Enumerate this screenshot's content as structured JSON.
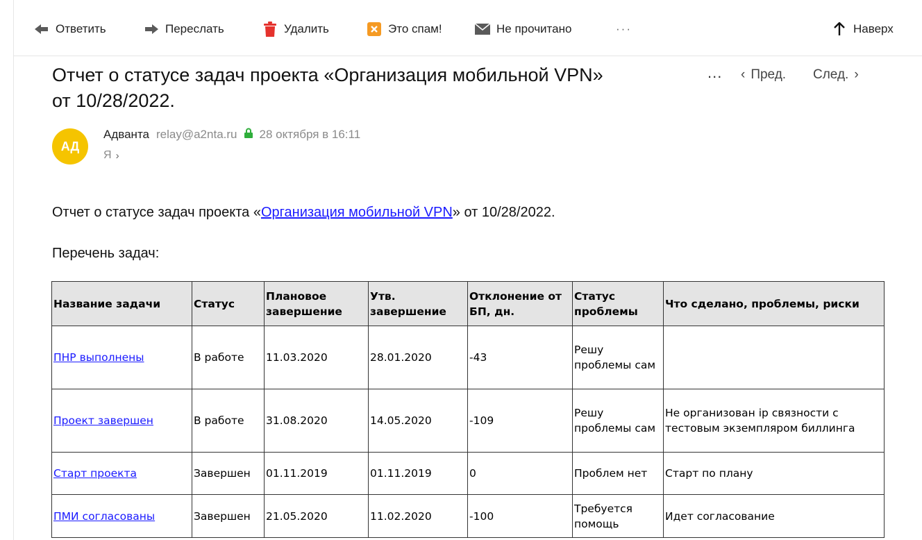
{
  "toolbar": {
    "reply": "Ответить",
    "forward": "Переслать",
    "delete": "Удалить",
    "spam": "Это спам!",
    "unread": "Не прочитано",
    "more": "···",
    "top": "Наверх"
  },
  "email": {
    "subject_line1": "Отчет о статусе задач проекта «Организация мобильной VPN»",
    "subject_line2": "от 10/28/2022.",
    "subject_more": "...",
    "prev": "Пред.",
    "next": "След.",
    "sender": {
      "avatar_initials": "АД",
      "name": "Адванта",
      "email": "relay@a2nta.ru",
      "date": "28 октября в 16:11",
      "recipient": "Я"
    },
    "intro_before": "Отчет о статусе задач проекта «",
    "intro_link": "Организация мобильной VPN",
    "intro_after": "» от 10/28/2022.",
    "list_title": "Перечень задач:"
  },
  "table": {
    "headers": [
      "Название задачи",
      "Статус",
      "Плановое завершение",
      "Утв. завершение",
      "Отклонение от БП, дн.",
      "Статус проблемы",
      "Что сделано, проблемы, риски"
    ],
    "rows": [
      {
        "name": "ПНР выполнены",
        "status": "В работе",
        "planned": "11.03.2020",
        "approved": "28.01.2020",
        "deviation": "-43",
        "problem": "Решу проблемы сам",
        "notes": ""
      },
      {
        "name": "Проект завершен",
        "status": "В работе",
        "planned": "31.08.2020",
        "approved": "14.05.2020",
        "deviation": "-109",
        "problem": "Решу проблемы сам",
        "notes": "Не организован ip связности с тестовым экземпляром биллинга"
      },
      {
        "name": "Старт проекта",
        "status": "Завершен",
        "planned": "01.11.2019",
        "approved": "01.11.2019",
        "deviation": "0",
        "problem": "Проблем нет",
        "notes": "Старт по плану"
      },
      {
        "name": "ПМИ согласованы",
        "status": "Завершен",
        "planned": "21.05.2020",
        "approved": "11.02.2020",
        "deviation": "-100",
        "problem": "Требуется помощь",
        "notes": "Идет согласование"
      }
    ]
  },
  "colors": {
    "avatar_bg": "#f5c400",
    "link": "#1a1aff",
    "delete_icon": "#e5322d",
    "spam_icon": "#f59a23",
    "lock_icon": "#2fae3b",
    "header_bg": "#e4e4e4"
  },
  "icons": {
    "reply": "reply-arrow-icon",
    "forward": "forward-arrow-icon",
    "delete": "trash-icon",
    "spam": "spam-icon",
    "unread": "envelope-icon",
    "top": "arrow-up-icon",
    "lock": "lock-icon"
  }
}
